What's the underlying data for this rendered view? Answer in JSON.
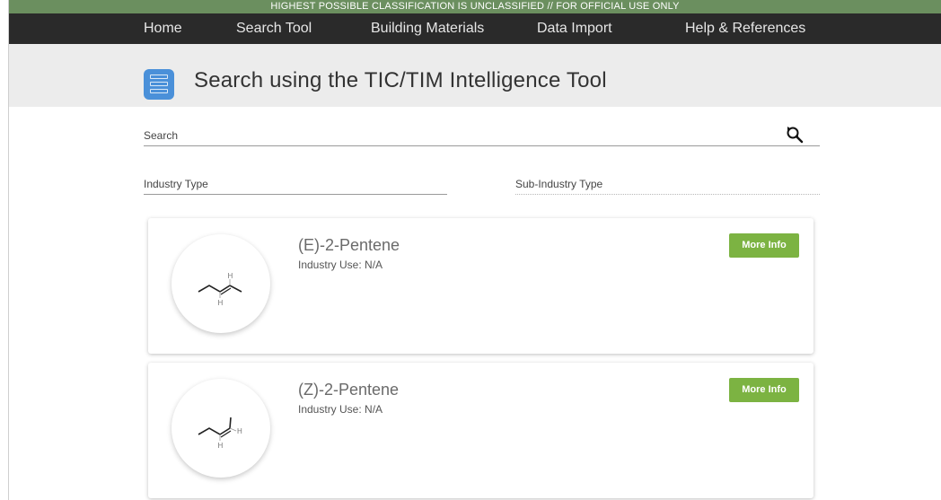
{
  "banner": {
    "text": "HIGHEST POSSIBLE CLASSIFICATION IS UNCLASSIFIED // FOR OFFICIAL USE ONLY"
  },
  "nav": {
    "items": [
      {
        "label": "Home"
      },
      {
        "label": "Search Tool"
      },
      {
        "label": "Building Materials"
      },
      {
        "label": "Data Import"
      },
      {
        "label": "Help & References"
      }
    ]
  },
  "header": {
    "title": "Search using the TIC/TIM Intelligence Tool",
    "icon": "list-document-icon"
  },
  "search": {
    "label": "Search",
    "value": "",
    "icon": "search-refresh-icon"
  },
  "filters": {
    "industry_type_label": "Industry Type",
    "sub_industry_type_label": "Sub-Industry Type"
  },
  "colors": {
    "classification_bar": "#6b8f5f",
    "nav_background": "#2a2a2a",
    "header_background": "#ececec",
    "title_icon": "#4a90d9",
    "button_green": "#7cb342"
  },
  "results": [
    {
      "name": "(E)-2-Pentene",
      "industry_use": "Industry Use: N/A",
      "button_label": "More Info",
      "structure_labels": [
        "H",
        "H"
      ]
    },
    {
      "name": "(Z)-2-Pentene",
      "industry_use": "Industry Use: N/A",
      "button_label": "More Info",
      "structure_labels": [
        "H",
        "H"
      ]
    }
  ]
}
